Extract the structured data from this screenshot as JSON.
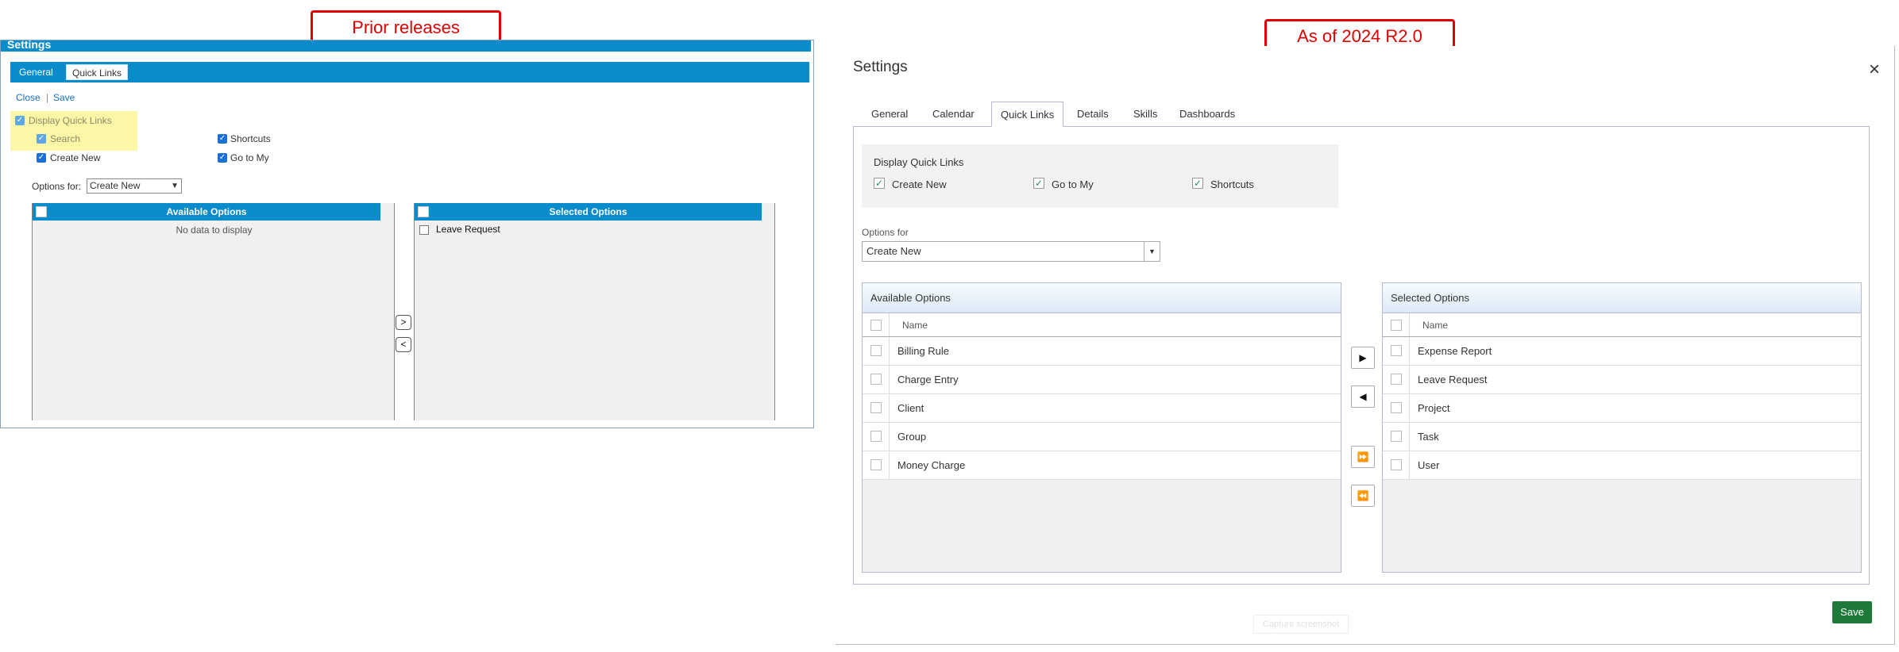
{
  "callouts": {
    "prior": "Prior releases",
    "new": "As of 2024 R2.0"
  },
  "old": {
    "title": "Settings",
    "tabs": [
      "General",
      "Quick Links"
    ],
    "links": {
      "close": "Close",
      "sep": "|",
      "save": "Save"
    },
    "display_quick_links": "Display Quick Links",
    "checkboxes": {
      "search": "Search",
      "shortcuts": "Shortcuts",
      "create_new": "Create New",
      "go_to_my": "Go to My"
    },
    "options_for_label": "Options for:",
    "options_for_value": "Create New",
    "available_header": "Available Options",
    "available_empty": "No data to display",
    "selected_header": "Selected Options",
    "selected_items": [
      "Leave Request"
    ],
    "move_right": ">",
    "move_left": "<"
  },
  "new": {
    "title": "Settings",
    "close_icon": "×",
    "tabs": [
      "General",
      "Calendar",
      "Quick Links",
      "Details",
      "Skills",
      "Dashboards"
    ],
    "active_tab": "Quick Links",
    "display_quick_links": "Display Quick Links",
    "checkboxes": [
      {
        "label": "Create New",
        "checked": true
      },
      {
        "label": "Go to My",
        "checked": true
      },
      {
        "label": "Shortcuts",
        "checked": true
      }
    ],
    "options_for_label": "Options for",
    "options_for_value": "Create New",
    "available": {
      "header": "Available Options",
      "column": "Name",
      "rows": [
        "Billing Rule",
        "Charge Entry",
        "Client",
        "Group",
        "Money Charge"
      ]
    },
    "selected": {
      "header": "Selected Options",
      "column": "Name",
      "rows": [
        "Expense Report",
        "Leave Request",
        "Project",
        "Task",
        "User"
      ]
    },
    "buttons": {
      "move_right": "▶",
      "move_left": "◀",
      "move_all_right": "⏩",
      "move_all_left": "⏪",
      "save": "Save"
    },
    "ghost_button": "Capture screenshot"
  },
  "colors": {
    "old_header": "#0a8ccc",
    "callout": "#e00000",
    "save": "#1e7a3a",
    "highlight": "#fbf7a6"
  }
}
